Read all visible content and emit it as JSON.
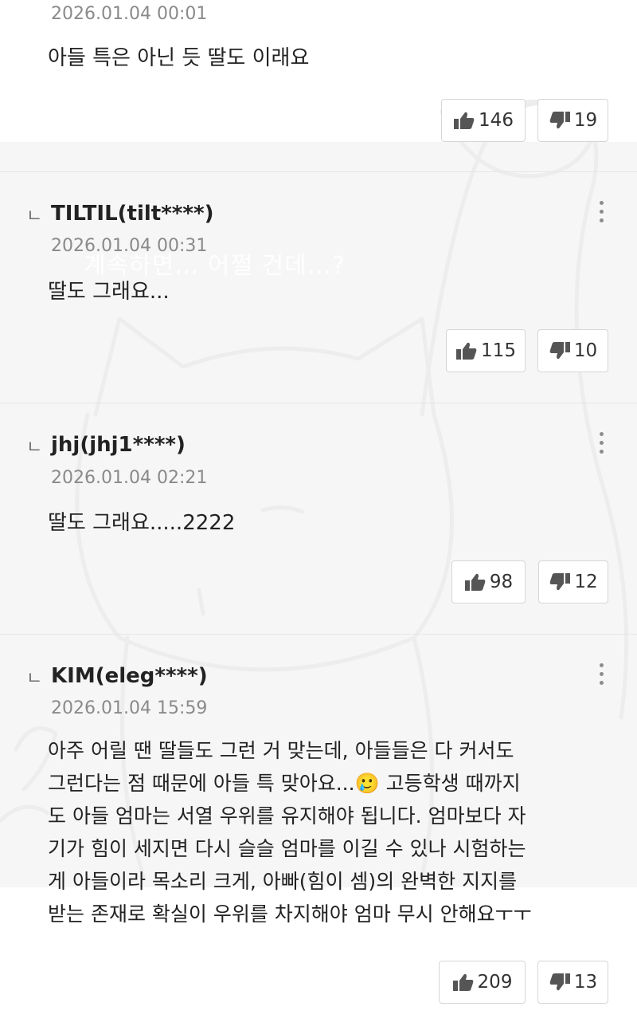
{
  "comments": [
    {
      "is_reply": false,
      "author": "",
      "date": "2026.01.04 00:01",
      "text": "아들 특은 아닌 듯 딸도 이래요",
      "likes": "146",
      "dislikes": "19"
    },
    {
      "is_reply": true,
      "author": "TILTIL(tilt****)",
      "date": "2026.01.04 00:31",
      "text": "딸도 그래요...",
      "likes": "115",
      "dislikes": "10"
    },
    {
      "is_reply": true,
      "author": "jhj(jhj1****)",
      "date": "2026.01.04 02:21",
      "text": "딸도 그래요.....2222",
      "likes": "98",
      "dislikes": "12"
    },
    {
      "is_reply": true,
      "author": "KIM(eleg****)",
      "date": "2026.01.04 15:59",
      "text": "아주 어릴 땐 딸들도 그런 거 맞는데, 아들들은 다 커서도\n그런다는 점 때문에 아들 특 맞아요...🥲 고등학생 때까지\n도 아들 엄마는 서열 우위를 유지해야 됩니다. 엄마보다 자\n기가 힘이 세지면 다시 슬슬 엄마를 이길 수 있나 시험하는\n게 아들이라 목소리 크게, 아빠(힘이 셈)의 완벽한 지지를\n받는 존재로 확실이 우위를 차지해야 엄마 무시 안해요ㅜㅜ",
      "likes": "209",
      "dislikes": "13"
    }
  ],
  "reply_marker": "ㄴ",
  "watermark_caption": "계속하면… 어쩔 건데…?",
  "icons": {
    "like": "thumbs-up-icon",
    "dislike": "thumbs-down-icon",
    "more": "more-vertical-icon"
  },
  "colors": {
    "background": "#ffffff",
    "band": "#f6f6f6",
    "text": "#222222",
    "date": "#8a8a8a",
    "icon": "#555555"
  }
}
